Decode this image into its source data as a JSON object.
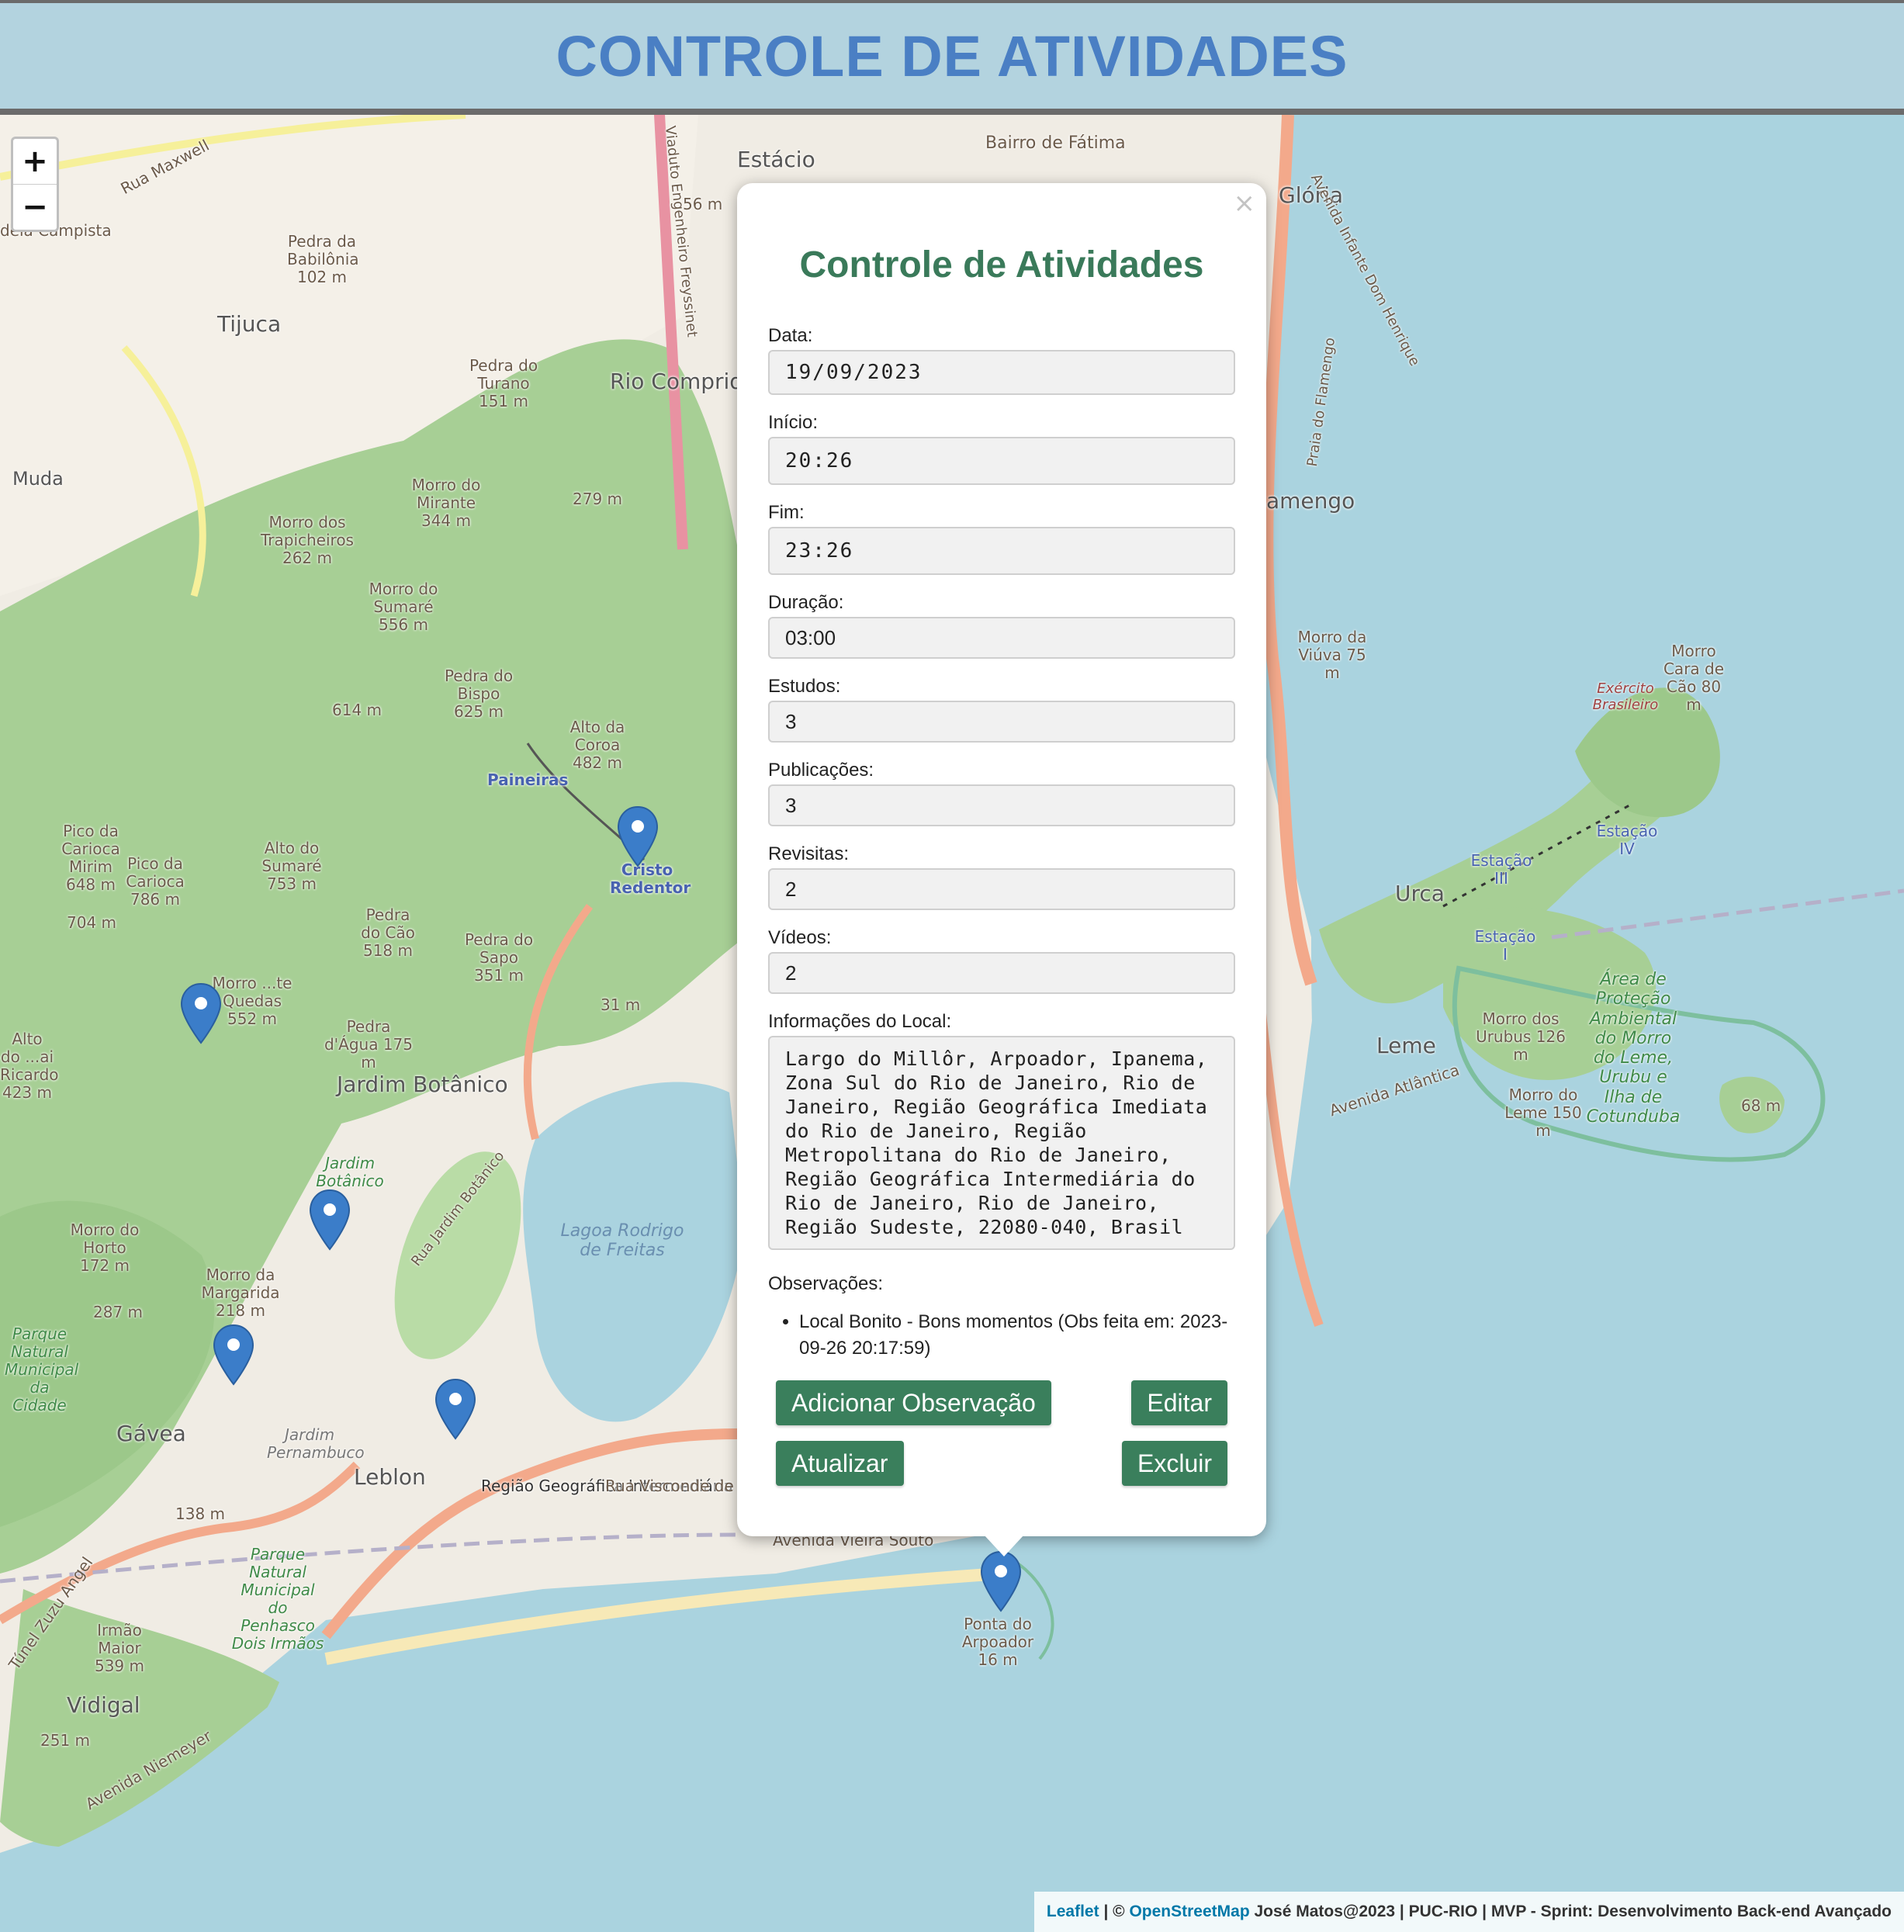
{
  "header": {
    "title": "CONTROLE DE ATIVIDADES"
  },
  "map": {
    "zoom_in": "+",
    "zoom_out": "−",
    "labels": {
      "estacio": "Estácio",
      "gloria": "Glória",
      "fatima": "Bairro de Fátima",
      "tijuca": "Tijuca",
      "muda": "Muda",
      "rio_comprido": "Rio Comprid",
      "flamengo": "amengo",
      "urca": "Urca",
      "leme": "Leme",
      "jardim_botanico": "Jardim Botânico",
      "gavea": "Gávea",
      "leblon": "Leblon",
      "vidigal": "Vidigal",
      "paineiras": "Paineiras",
      "cristo": "Cristo Redentor",
      "lagoa": "Lagoa Rodrigo de Freitas",
      "arpoador": "Ponta do Arpoador 16 m",
      "babilonia": "Pedra da Babilônia 102 m",
      "turano": "Pedra do Turano 151 m",
      "mirante": "Morro do Mirante 344 m",
      "trapicheiros": "Morro dos Trapicheiros 262 m",
      "sumare": "Morro do Sumaré 556 m",
      "bispo": "Pedra do Bispo 625 m",
      "coroa": "Alto da Coroa 482 m",
      "carioca": "Pico da Carioca 786 m",
      "alto_sumare": "Alto do Sumaré 753 m",
      "pedra_cao": "Pedra do Cão 518 m",
      "sapo": "Pedra do Sapo 351 m",
      "sete_quedas": "Morro ...te Quedas 552 m",
      "pedra_agua": "Pedra d'Água 175 m",
      "horto": "Morro do Horto 172 m",
      "margarida": "Morro da Margarida 218 m",
      "irmao": "Irmão Maior 539 m",
      "viuva": "Morro da Viúva 75 m",
      "cara_cao": "Morro Cara de Cão 80 m",
      "urubus": "Morro dos Urubus 126 m",
      "morro_leme": "Morro do Leme 150 m",
      "area_protecao": "Área de Proteção Ambiental do Morro do Leme, Urubu e Ilha de Cotunduba",
      "regiao": "Região Geográfica Intermediária do Rio de Janeiro",
      "av_atlantica": "Avenida Atlântica",
      "visconde": "Rua Visconde de Pir",
      "vieira_souto": "Avenida Vieira Souto",
      "niemeyer": "Avenida Niemeyer",
      "tunel": "Túnel Zuzu Angel",
      "parque_cidade": "Parque Natural Municipal da Cidade",
      "parque_penhasco": "Parque Natural Municipal do Penhasco Dois Irmãos",
      "exercito": "Exército Brasileiro",
      "rua_maxwell": "Rua Maxwell",
      "campista": "deia Campista",
      "estacao1": "Estação I",
      "estacao3": "Estação III",
      "estacao4": "Estação IV",
      "jardim_pernambuco": "Jardim Pernambuco",
      "jardim_bot_park": "Jardim Botânico",
      "viaduto": "Viaduto Engenheiro Freyssinet",
      "praia_flamengo": "Praia do Flamengo",
      "infante": "Avenida Infante Dom Henrique",
      "rua_jardim": "Rua Jardim Botânico",
      "m56": "56 m",
      "m279": "279 m",
      "m614": "614 m",
      "m704": "704 m",
      "m648": "Pico da Carioca Mirim 648 m",
      "m423": "Alto do ...ai Ricardo 423 m",
      "m31": "31 m",
      "m287": "287 m",
      "m138": "138 m",
      "m251": "251 m",
      "m68": "68 m"
    }
  },
  "popup": {
    "close": "×",
    "title": "Controle de Atividades",
    "fields": {
      "data_label": "Data:",
      "data_value": "19/09/2023",
      "inicio_label": "Início:",
      "inicio_value": "20:26",
      "fim_label": "Fim:",
      "fim_value": "23:26",
      "duracao_label": "Duração:",
      "duracao_value": "03:00",
      "estudos_label": "Estudos:",
      "estudos_value": "3",
      "publicacoes_label": "Publicações:",
      "publicacoes_value": "3",
      "revisitas_label": "Revisitas:",
      "revisitas_value": "2",
      "videos_label": "Vídeos:",
      "videos_value": "2",
      "local_label": "Informações do Local:",
      "local_value": "Largo do Millôr, Arpoador, Ipanema, Zona Sul do Rio de Janeiro, Rio de Janeiro, Região Geográfica Imediata do Rio de Janeiro, Região Metropolitana do Rio de Janeiro, Região Geográfica Intermediária do Rio de Janeiro, Rio de Janeiro, Região Sudeste, 22080-040, Brasil"
    },
    "observacoes_label": "Observações:",
    "observacoes": [
      "Local Bonito - Bons momentos (Obs feita em: 2023-09-26 20:17:59)"
    ],
    "buttons": {
      "add_obs": "Adicionar Observação",
      "edit": "Editar",
      "update": "Atualizar",
      "delete": "Excluir"
    }
  },
  "attribution": {
    "leaflet": "Leaflet",
    "sep": " | © ",
    "osm": "OpenStreetMap",
    "text": " José Matos@2023 | PUC-RIO | MVP - Sprint: Desenvolvimento Back-end Avançado"
  },
  "colors": {
    "header_title": "#4a7fc4",
    "popup_title": "#3a7a5a",
    "button": "#3a7f5c",
    "water": "#aad3df",
    "forest": "#a7cf95",
    "marker": "#3b7dc9"
  }
}
